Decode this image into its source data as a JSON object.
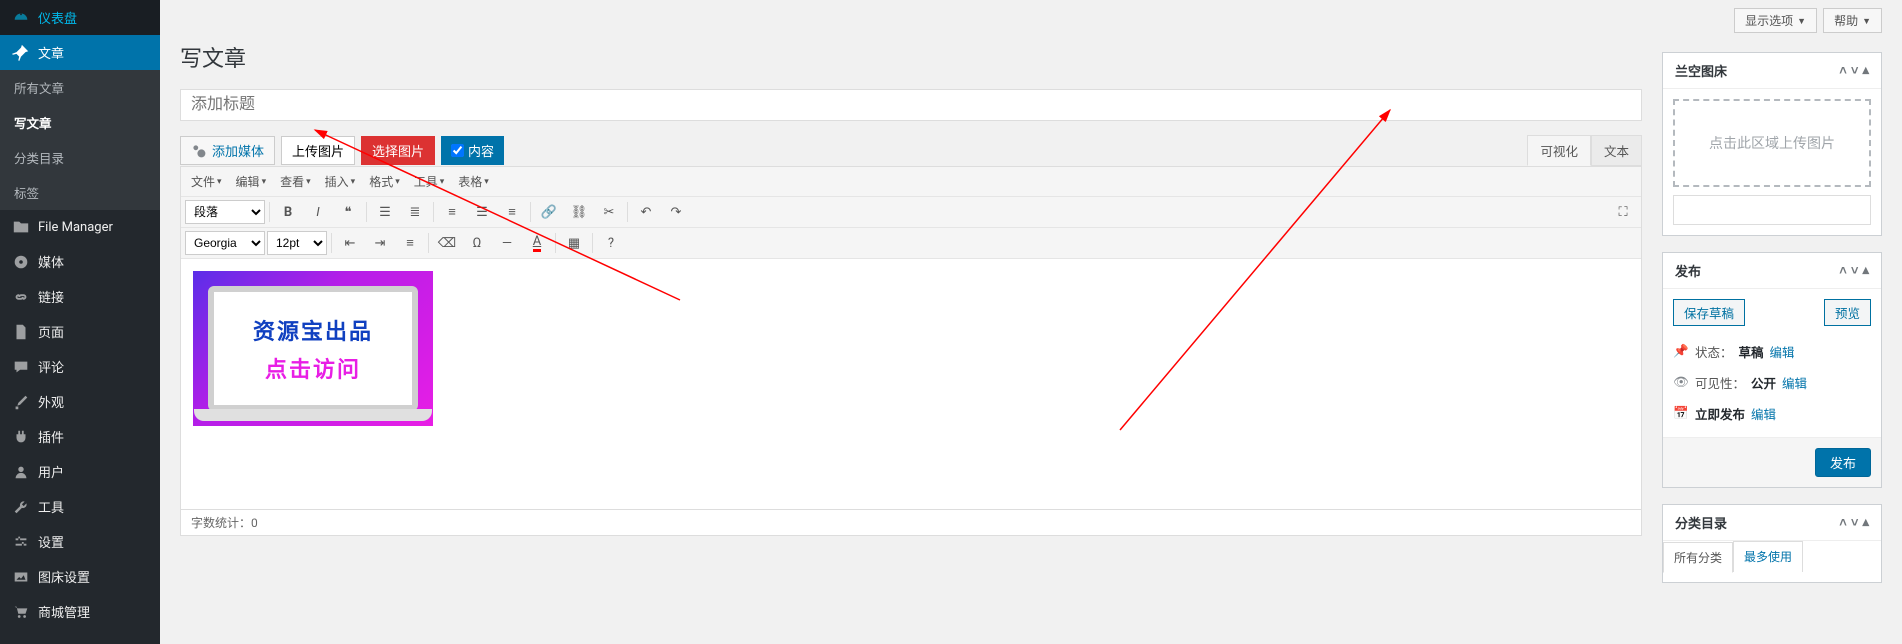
{
  "sidebar": {
    "items": [
      {
        "label": "仪表盘",
        "icon": "dashboard"
      },
      {
        "label": "文章",
        "icon": "pin",
        "active": true
      },
      {
        "label": "所有文章",
        "sub": true
      },
      {
        "label": "写文章",
        "sub": true,
        "current": true
      },
      {
        "label": "分类目录",
        "sub": true
      },
      {
        "label": "标签",
        "sub": true
      },
      {
        "label": "File Manager",
        "icon": "folder"
      },
      {
        "label": "媒体",
        "icon": "media"
      },
      {
        "label": "链接",
        "icon": "link"
      },
      {
        "label": "页面",
        "icon": "page"
      },
      {
        "label": "评论",
        "icon": "comment"
      },
      {
        "label": "外观",
        "icon": "brush"
      },
      {
        "label": "插件",
        "icon": "plug"
      },
      {
        "label": "用户",
        "icon": "user"
      },
      {
        "label": "工具",
        "icon": "tool"
      },
      {
        "label": "设置",
        "icon": "settings"
      },
      {
        "label": "图床设置",
        "icon": "gallery"
      },
      {
        "label": "商城管理",
        "icon": "cart"
      }
    ]
  },
  "header": {
    "screen_options": "显示选项",
    "help": "帮助"
  },
  "page_title": "写文章",
  "title_placeholder": "添加标题",
  "media": {
    "add_media": "添加媒体",
    "upload_img": "上传图片",
    "select_img": "选择图片",
    "content_label": "内容"
  },
  "editor_tabs": {
    "visual": "可视化",
    "text": "文本"
  },
  "tinymce": {
    "menus": [
      "文件",
      "编辑",
      "查看",
      "插入",
      "格式",
      "工具",
      "表格"
    ],
    "format_sel": "段落",
    "font_family": "Georgia",
    "font_size": "12pt"
  },
  "content_image": {
    "line1": "资源宝出品",
    "line2": "点击访问"
  },
  "status_bar": {
    "label": "字数统计：",
    "count": "0"
  },
  "metabox_image": {
    "title": "兰空图床",
    "dropzone": "点击此区域上传图片"
  },
  "metabox_publish": {
    "title": "发布",
    "save_draft": "保存草稿",
    "preview": "预览",
    "status_label": "状态：",
    "status_value": "草稿",
    "edit_link": "编辑",
    "visibility_label": "可见性：",
    "visibility_value": "公开",
    "schedule_label": "立即发布",
    "publish_btn": "发布"
  },
  "metabox_cat": {
    "title": "分类目录",
    "tab_all": "所有分类",
    "tab_most": "最多使用"
  }
}
